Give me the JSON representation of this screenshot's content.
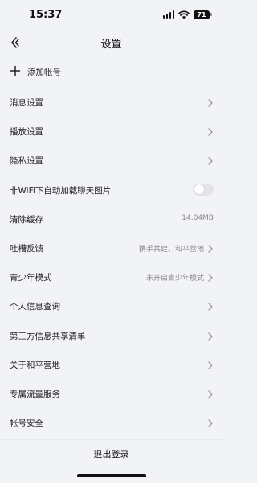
{
  "status_bar": {
    "time": "15:37",
    "battery": "71"
  },
  "nav": {
    "title": "设置"
  },
  "add_account": {
    "label": "添加帐号"
  },
  "settings": [
    {
      "label": "消息设置",
      "value": "",
      "control": "chevron"
    },
    {
      "label": "播放设置",
      "value": "",
      "control": "chevron"
    },
    {
      "label": "隐私设置",
      "value": "",
      "control": "chevron"
    },
    {
      "label": "非WiFi下自动加载聊天图片",
      "value": "",
      "control": "toggle",
      "toggle_on": false
    },
    {
      "label": "清除缓存",
      "value": "14.04MB",
      "control": "none"
    },
    {
      "label": "吐槽反馈",
      "value": "携手共建，和平营地",
      "control": "chevron"
    },
    {
      "label": "青少年模式",
      "value": "未开启青少年模式",
      "control": "chevron"
    },
    {
      "label": "个人信息查询",
      "value": "",
      "control": "chevron"
    },
    {
      "label": "第三方信息共享清单",
      "value": "",
      "control": "chevron"
    },
    {
      "label": "关于和平营地",
      "value": "",
      "control": "chevron"
    },
    {
      "label": "专属流量服务",
      "value": "",
      "control": "chevron"
    },
    {
      "label": "帐号安全",
      "value": "",
      "control": "chevron"
    }
  ],
  "logout": {
    "label": "退出登录"
  },
  "colors": {
    "background": "#f2f3f7",
    "text": "#222222",
    "secondary_text": "#888888",
    "toggle_off": "#e3e4e9"
  }
}
